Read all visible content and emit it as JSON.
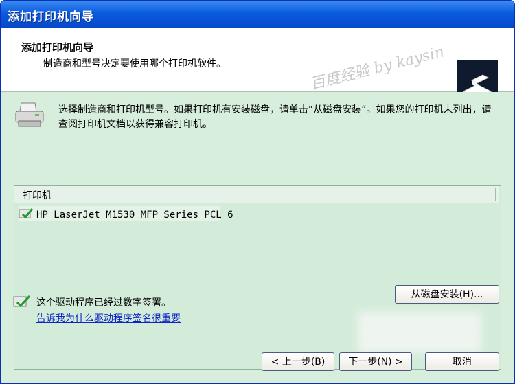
{
  "window": {
    "title": "添加打印机向导"
  },
  "header": {
    "title": "添加打印机向导",
    "subtitle": "制造商和型号决定要使用哪个打印机软件。",
    "watermark": "百度经验 by kaysin"
  },
  "instructions": "选择制造商和打印机型号。如果打印机有安装磁盘，请单击“从磁盘安装”。如果您的打印机未列出，请查阅打印机文档以获得兼容打印机。",
  "printer_list": {
    "column_header": "打印机",
    "items": [
      {
        "label": "HP LaserJet M1530 MFP Series PCL 6"
      }
    ]
  },
  "signature": {
    "text": "这个驱动程序已经过数字签署。",
    "link": "告诉我为什么驱动程序签名很重要"
  },
  "buttons": {
    "have_disk": "从磁盘安装(H)...",
    "back": "< 上一步(B)",
    "next": "下一步(N) >",
    "cancel": "取消"
  },
  "colors": {
    "titlebar": "#0a5ae0",
    "panel_bg": "#d7eedd",
    "link": "#0d24c4"
  },
  "icons": [
    "printer-wizard-icon",
    "printer-icon",
    "certified-driver-icon"
  ]
}
